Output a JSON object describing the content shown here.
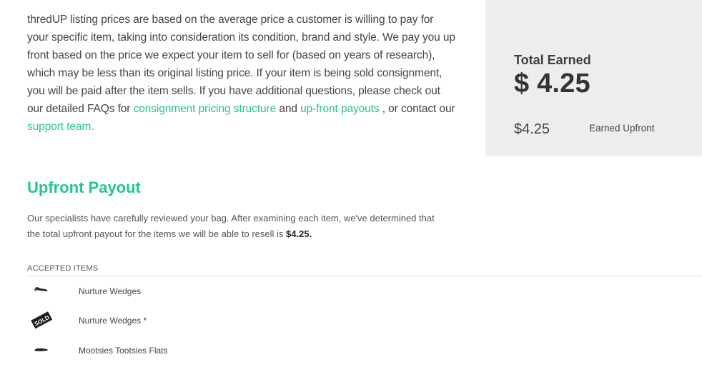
{
  "intro": {
    "text_1": "thredUP listing prices are based on the average price a customer is willing to pay for your specific item, taking into consideration its condition, brand and style. We pay you up front based on the price we expect your item to sell for (based on years of research), which may be less than its original listing price. If your item is being sold consignment, you will be paid after the item sells. If you have additional questions, please check out our detailed FAQs for ",
    "link_consignment": "consignment pricing structure",
    "text_2": " and ",
    "link_upfront": "up-front payouts",
    "text_3": " , or contact our ",
    "link_support": "support team."
  },
  "earned": {
    "label": "Total Earned",
    "total": "$ 4.25",
    "row_amount": "$4.25",
    "row_label": "Earned Upfront"
  },
  "upfront": {
    "title": "Upfront Payout",
    "desc_text": "Our specialists have carefully reviewed your bag. After examining each item, we've determined that the total upfront payout for the items we will be able to resell is ",
    "desc_amount": "$4.25."
  },
  "accepted": {
    "header": "ACCEPTED ITEMS",
    "items": [
      {
        "name": "Nurture Wedges",
        "thumb": "shoe-thumbnail"
      },
      {
        "name": "Nurture Wedges *",
        "thumb": "sold-badge",
        "badge": "SOLD"
      },
      {
        "name": "Mootsies Tootsies Flats",
        "thumb": "shoe-thumbnail"
      }
    ]
  },
  "colors": {
    "accent": "#25c491",
    "panel_bg": "#ededed",
    "text": "#444444"
  }
}
